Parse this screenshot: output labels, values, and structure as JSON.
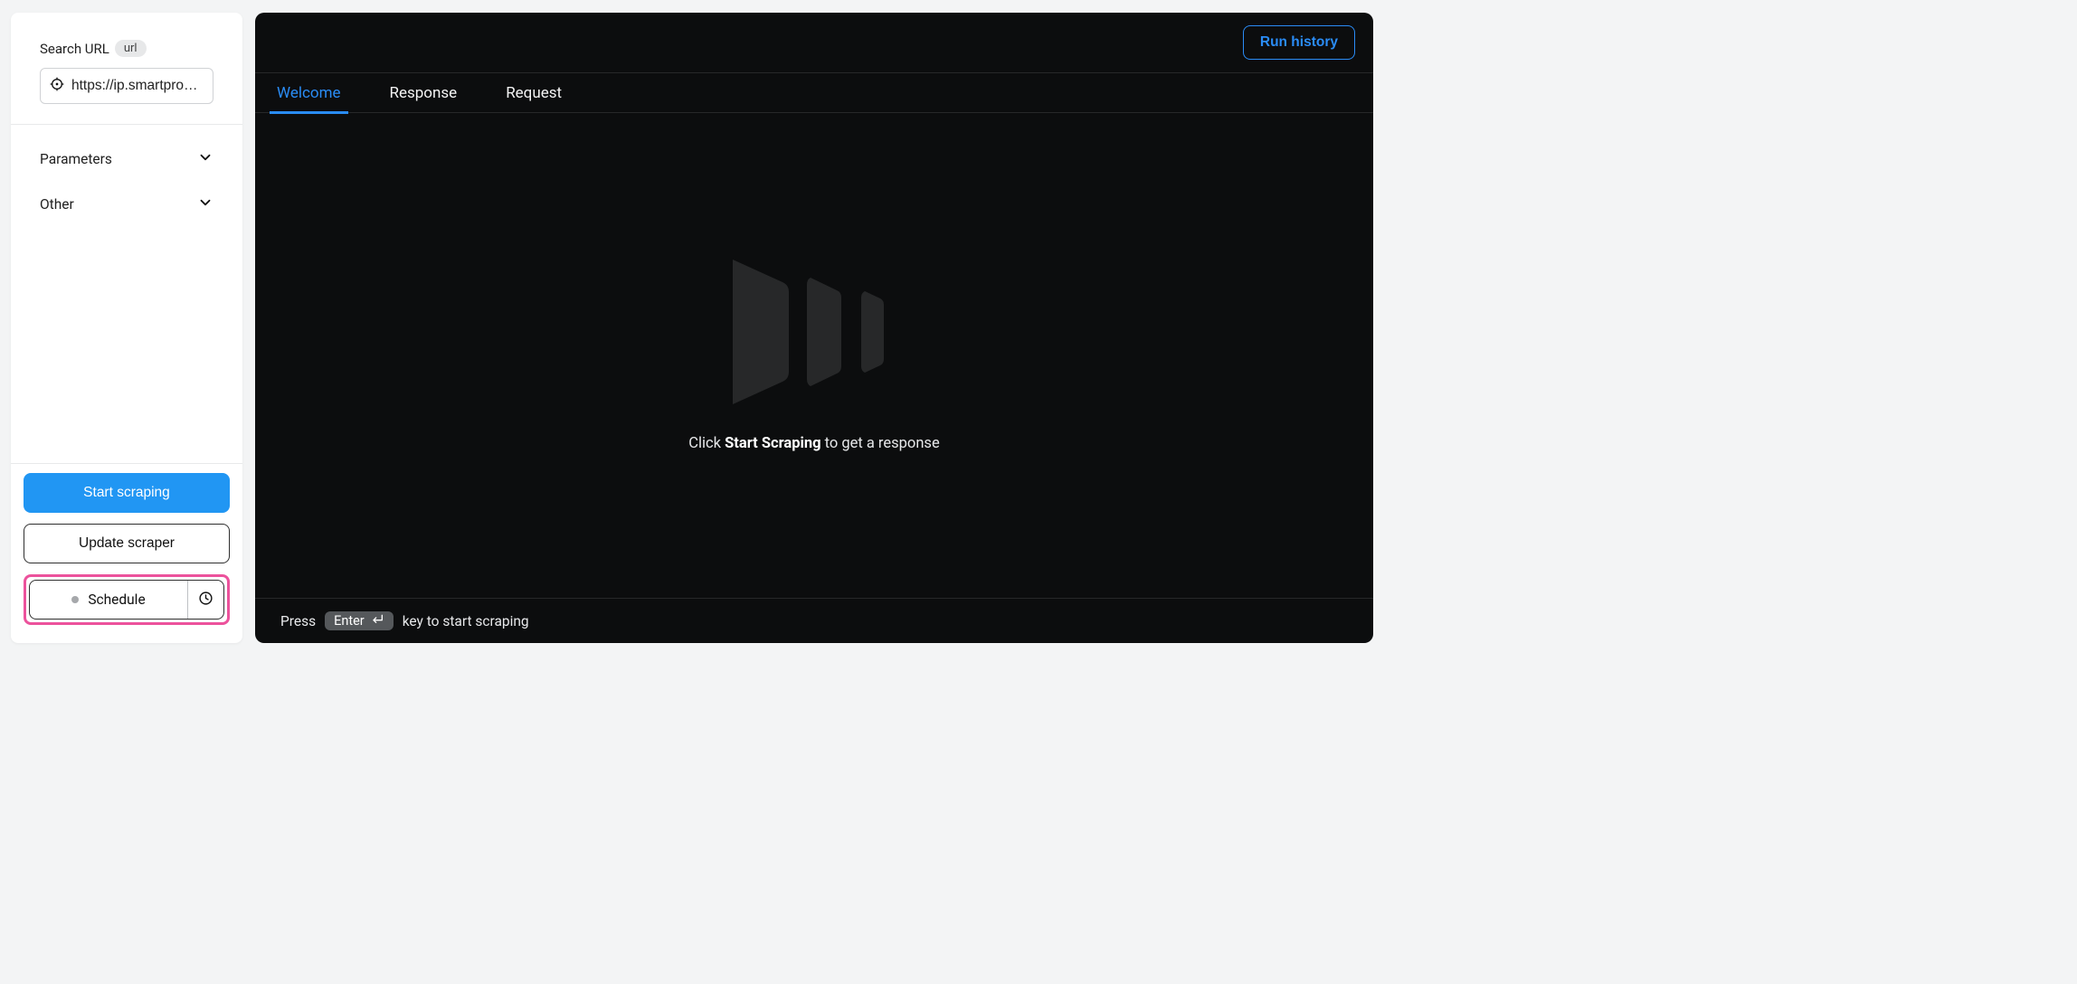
{
  "sidebar": {
    "url_label": "Search URL",
    "url_badge": "url",
    "url_value": "https://ip.smartproxy.com",
    "accordion": {
      "parameters": "Parameters",
      "other": "Other"
    },
    "buttons": {
      "start": "Start scraping",
      "update": "Update scraper",
      "schedule": "Schedule"
    }
  },
  "main": {
    "run_history": "Run history",
    "tabs": {
      "welcome": "Welcome",
      "response": "Response",
      "request": "Request"
    },
    "welcome": {
      "cta_prefix": "Click ",
      "cta_strong": "Start Scraping",
      "cta_suffix": " to get a response"
    },
    "footer": {
      "press": "Press",
      "enter": "Enter",
      "rest": "key to start scraping"
    }
  }
}
